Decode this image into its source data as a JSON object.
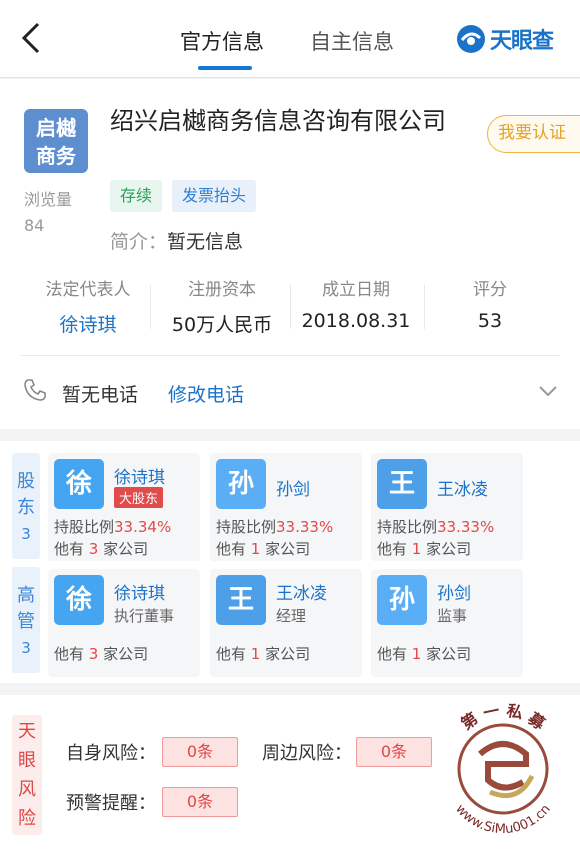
{
  "header": {
    "tabs": [
      {
        "label": "官方信息",
        "active": true
      },
      {
        "label": "自主信息",
        "active": false
      }
    ],
    "logo_text": "天眼查"
  },
  "company": {
    "logo_chars": [
      "启樾",
      "商务"
    ],
    "views_label": "浏览量",
    "views_value": "84",
    "name": "绍兴启樾商务信息咨询有限公司",
    "claim_button": "我要认证",
    "tags": [
      "存续",
      "发票抬头"
    ],
    "intro_label": "简介：",
    "intro_value": "暂无信息",
    "stats": [
      {
        "label": "法定代表人",
        "value": "徐诗琪",
        "link": true
      },
      {
        "label": "注册资本",
        "value": "50万人民币",
        "link": false
      },
      {
        "label": "成立日期",
        "value": "2018.08.31",
        "link": false
      },
      {
        "label": "评分",
        "value": "53",
        "link": false
      }
    ],
    "phone_text": "暂无电话",
    "phone_edit": "修改电话"
  },
  "shareholders": {
    "label": [
      "股",
      "东",
      "3"
    ],
    "items": [
      {
        "avatar": "徐",
        "name": "徐诗琪",
        "badge": "大股东",
        "ratio_label": "持股比例",
        "ratio": "33.34%",
        "others_prefix": "他有",
        "others_count": "3",
        "others_suffix": "家公司"
      },
      {
        "avatar": "孙",
        "name": "孙剑",
        "ratio_label": "持股比例",
        "ratio": "33.33%",
        "others_prefix": "他有",
        "others_count": "1",
        "others_suffix": "家公司"
      },
      {
        "avatar": "王",
        "name": "王冰凌",
        "ratio_label": "持股比例",
        "ratio": "33.33%",
        "others_prefix": "他有",
        "others_count": "1",
        "others_suffix": "家公司"
      }
    ]
  },
  "management": {
    "label": [
      "高",
      "管",
      "3"
    ],
    "items": [
      {
        "avatar": "徐",
        "name": "徐诗琪",
        "role": "执行董事",
        "others_prefix": "他有",
        "others_count": "3",
        "others_suffix": "家公司"
      },
      {
        "avatar": "王",
        "name": "王冰凌",
        "role": "经理",
        "others_prefix": "他有",
        "others_count": "1",
        "others_suffix": "家公司"
      },
      {
        "avatar": "孙",
        "name": "孙剑",
        "role": "监事",
        "others_prefix": "他有",
        "others_count": "1",
        "others_suffix": "家公司"
      }
    ]
  },
  "risk": {
    "label": [
      "天",
      "眼",
      "风",
      "险"
    ],
    "self_label": "自身风险：",
    "self_value": "0条",
    "around_label": "周边风险：",
    "around_value": "0条",
    "warn_label": "预警提醒：",
    "warn_value": "0条"
  },
  "watermark": {
    "top_text": "第 一 私 募",
    "bottom_text": "www.SiMu001.cn"
  },
  "colors": {
    "accent": "#1a73c8",
    "danger": "#e04646",
    "tag_green": "#2aa05a",
    "claim": "#e8a020"
  }
}
